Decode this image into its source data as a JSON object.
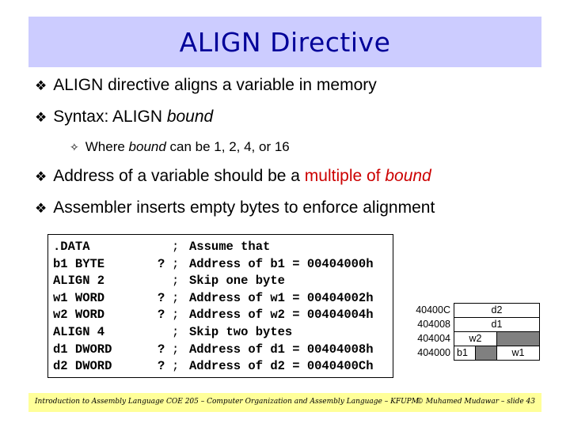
{
  "title": "ALIGN Directive",
  "bullets": [
    {
      "text": "ALIGN directive aligns a variable in memory"
    },
    {
      "prefix": "Syntax: ALIGN ",
      "italic": "bound"
    },
    {
      "sub": true,
      "prefix": "Where ",
      "italic": "bound",
      "suffix": " can be 1, 2, 4, or 16"
    },
    {
      "prefix": "Address of a variable should be a ",
      "red": "multiple of ",
      "red_italic": "bound"
    },
    {
      "text": "Assembler inserts empty bytes to enforce alignment"
    }
  ],
  "bullet_glyph": "❖",
  "sub_glyph": "✧",
  "code": [
    {
      "decl": ".DATA",
      "q": "",
      "comment": "Assume that"
    },
    {
      "decl": "b1 BYTE",
      "q": "?",
      "comment": "Address of b1 = 00404000h"
    },
    {
      "decl": "ALIGN 2",
      "q": "",
      "comment": "Skip one byte"
    },
    {
      "decl": "w1 WORD",
      "q": "?",
      "comment": "Address of w1 = 00404002h"
    },
    {
      "decl": "w2 WORD",
      "q": "?",
      "comment": "Address of w2 = 00404004h"
    },
    {
      "decl": "ALIGN 4",
      "q": "",
      "comment": "Skip two bytes"
    },
    {
      "decl": "d1 DWORD",
      "q": "?",
      "comment": "Address of d1 = 00404008h"
    },
    {
      "decl": "d2 DWORD",
      "q": "?",
      "comment": "Address of d2 = 0040400Ch"
    }
  ],
  "code_semicolon": ";",
  "memory": {
    "addresses": [
      "40400C",
      "404008",
      "404004",
      "404000"
    ],
    "rows": {
      "r0": {
        "d2": "d2"
      },
      "r1": {
        "d1": "d1"
      },
      "r2": {
        "w2": "w2",
        "pad": ""
      },
      "r3": {
        "b1": "b1",
        "pad": "",
        "w1": "w1"
      }
    }
  },
  "footer": {
    "left": "Introduction to Assembly Language",
    "center": "COE 205 – Computer Organization and Assembly Language – KFUPM",
    "right": "© Muhamed Mudawar – slide 43"
  }
}
